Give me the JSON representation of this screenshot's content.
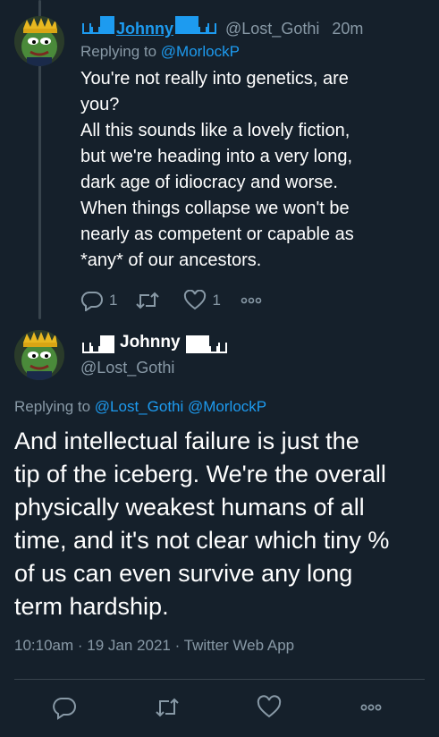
{
  "reply": {
    "name": "Johnny",
    "handle": "@Lost_Gothi",
    "time": "20m",
    "replying_prefix": "Replying to",
    "replying_to": "@MorlockP",
    "lines": [
      "You're not really into genetics, are",
      "you?",
      "All this sounds like a lovely fiction,",
      "but we're heading into a very long,",
      "dark age of idiocracy and worse.",
      "When things collapse we won't be",
      "nearly as competent or capable as",
      "*any* of our ancestors."
    ],
    "reply_count": "1",
    "like_count": "1"
  },
  "main": {
    "name": "Johnny",
    "handle": "@Lost_Gothi",
    "replying_prefix": "Replying to",
    "replying_to_1": "@Lost_Gothi",
    "replying_to_2": "@MorlockP",
    "lines": [
      "And intellectual failure is just the",
      "tip of the iceberg.  We're the overall",
      "physically weakest humans of all",
      "time, and it's not clear which tiny %",
      "of us can even survive any long",
      "term hardship."
    ],
    "meta": "10:10am · 19 Jan 2021 · Twitter Web App"
  },
  "icons": {
    "reply": "reply-icon",
    "retweet": "retweet-icon",
    "like": "heart-icon",
    "more": "more-icon"
  },
  "colors": {
    "background": "#15202b",
    "accent": "#1d9bf0",
    "muted": "#8899a6",
    "divider": "#38444d"
  }
}
